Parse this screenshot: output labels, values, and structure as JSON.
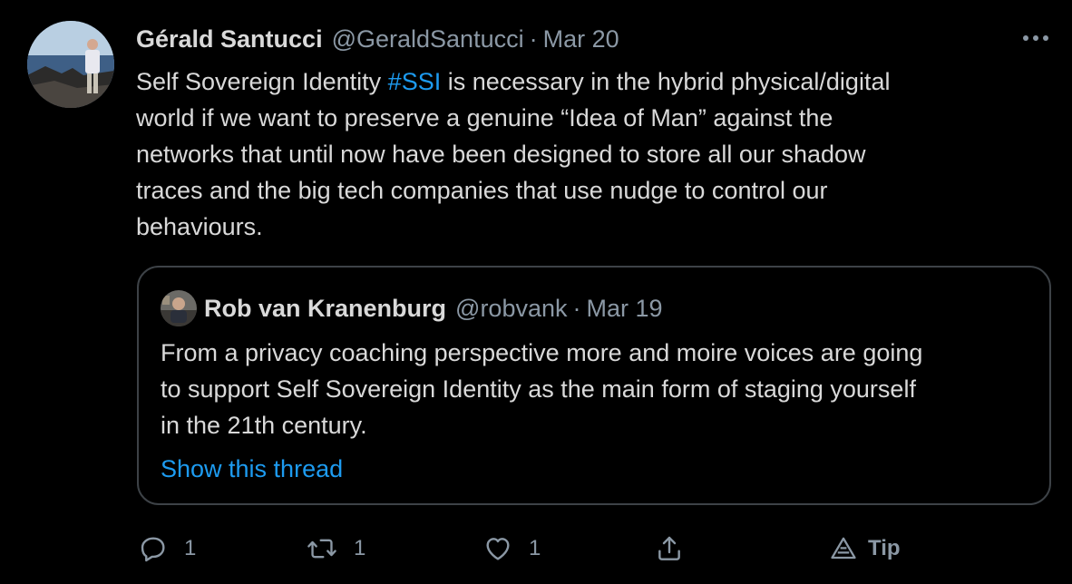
{
  "tweet": {
    "display_name": "Gérald Santucci",
    "handle": "@GeraldSantucci",
    "separator": "·",
    "date": "Mar 20",
    "text_lines": [
      {
        "before": "Self Sovereign Identity ",
        "hashtag": "#SSI",
        "after": " is necessary in the hybrid physical/digital"
      },
      "world if we want to preserve a genuine “Idea of Man” against the",
      "networks that until now have been designed to store all our shadow",
      "traces and the big tech companies that use nudge to control our",
      "behaviours."
    ]
  },
  "quote": {
    "display_name": "Rob van Kranenburg",
    "handle": "@robvank",
    "separator": "·",
    "date": "Mar 19",
    "text_lines": [
      "From a privacy coaching perspective more and moire voices are going",
      "to support Self Sovereign Identity as the main form of staging yourself",
      "in the 21th century."
    ],
    "show_thread_label": "Show this thread"
  },
  "actions": {
    "reply_count": "1",
    "retweet_count": "1",
    "like_count": "1",
    "tip_label": "Tip"
  },
  "icons": {
    "more": "more-horizontal-icon",
    "reply": "reply-icon",
    "retweet": "retweet-icon",
    "like": "heart-icon",
    "share": "share-icon",
    "tip": "tip-icon"
  },
  "colors": {
    "background": "#000000",
    "text": "#d9d9d9",
    "secondary": "#8b98a5",
    "link": "#1d9bf0",
    "border": "#3d4247"
  }
}
